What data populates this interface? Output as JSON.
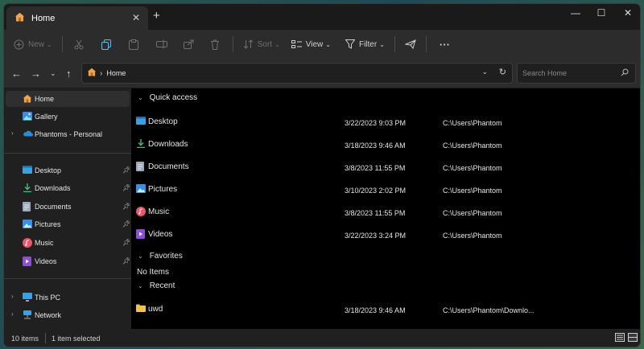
{
  "tab": {
    "title": "Home",
    "close": "✕",
    "new": "+"
  },
  "window_controls": {
    "minimize": "—",
    "maximize": "☐",
    "close": "✕"
  },
  "toolbar": {
    "new_label": "New",
    "sort_label": "Sort",
    "view_label": "View",
    "filter_label": "Filter",
    "more": "···"
  },
  "address": {
    "separator": "›",
    "crumb": "Home"
  },
  "search": {
    "placeholder": "Search Home"
  },
  "sidebar": {
    "top": [
      {
        "label": "Home",
        "icon": "home-icon",
        "selected": true
      },
      {
        "label": "Gallery",
        "icon": "gallery-icon"
      },
      {
        "label": "Phantoms - Personal",
        "icon": "cloud-icon",
        "expand": "›"
      }
    ],
    "pinned": [
      {
        "label": "Desktop",
        "icon": "desktop-icon"
      },
      {
        "label": "Downloads",
        "icon": "download-icon"
      },
      {
        "label": "Documents",
        "icon": "document-icon"
      },
      {
        "label": "Pictures",
        "icon": "picture-icon"
      },
      {
        "label": "Music",
        "icon": "music-icon"
      },
      {
        "label": "Videos",
        "icon": "video-icon"
      }
    ],
    "bottom": [
      {
        "label": "This PC",
        "icon": "pc-icon",
        "expand": "›"
      },
      {
        "label": "Network",
        "icon": "network-icon",
        "expand": "›"
      }
    ]
  },
  "groups": {
    "quick_access": "Quick access",
    "favorites": "Favorites",
    "recent": "Recent",
    "no_items": "No Items"
  },
  "quick_access": [
    {
      "name": "Desktop",
      "date": "3/22/2023 9:03 PM",
      "path": "C:\\Users\\Phantom",
      "icon": "desktop-icon"
    },
    {
      "name": "Downloads",
      "date": "3/18/2023 9:46 AM",
      "path": "C:\\Users\\Phantom",
      "icon": "download-icon"
    },
    {
      "name": "Documents",
      "date": "3/8/2023 11:55 PM",
      "path": "C:\\Users\\Phantom",
      "icon": "document-icon"
    },
    {
      "name": "Pictures",
      "date": "3/10/2023 2:02 PM",
      "path": "C:\\Users\\Phantom",
      "icon": "picture-icon"
    },
    {
      "name": "Music",
      "date": "3/8/2023 11:55 PM",
      "path": "C:\\Users\\Phantom",
      "icon": "music-icon"
    },
    {
      "name": "Videos",
      "date": "3/22/2023 3:24 PM",
      "path": "C:\\Users\\Phantom",
      "icon": "video-icon"
    }
  ],
  "recent": [
    {
      "name": "uwd",
      "date": "3/18/2023 9:46 AM",
      "path": "C:\\Users\\Phantom\\Downlo...",
      "icon": "folder-icon"
    }
  ],
  "status": {
    "items": "10 items",
    "selected": "1 item selected"
  },
  "colors": {
    "accent": "#4cc2ff",
    "home": "#f2a44a",
    "window_bg": "#202020",
    "content_bg": "#000000"
  }
}
